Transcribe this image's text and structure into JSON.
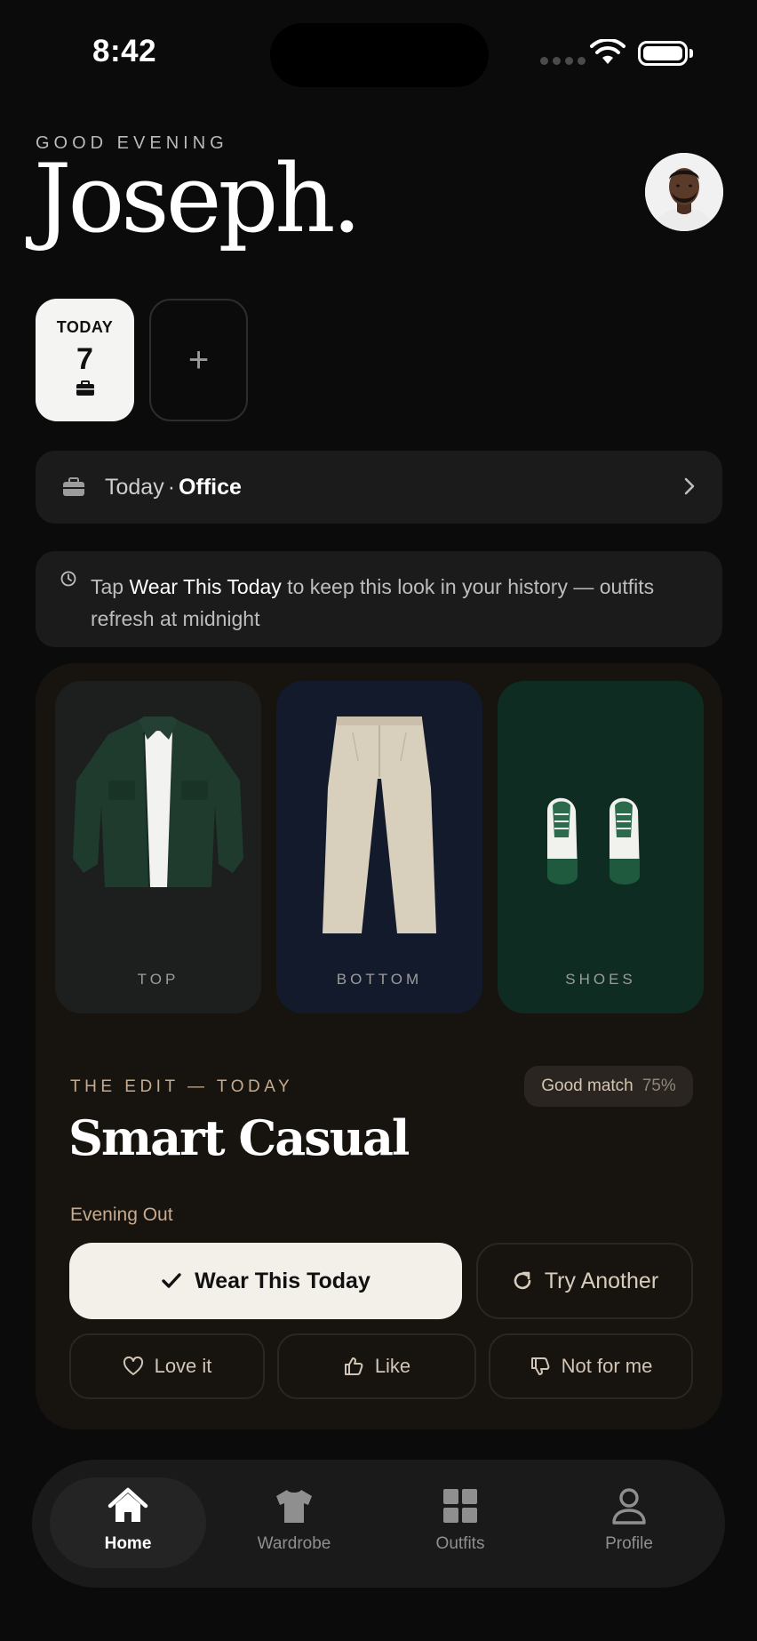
{
  "status_bar": {
    "time": "8:42"
  },
  "header": {
    "greeting": "GOOD EVENING",
    "name": "Joseph."
  },
  "date_chips": {
    "today_label": "TODAY",
    "today_number": "7",
    "add_label": "+"
  },
  "occasion": {
    "day": "Today",
    "separator": "·",
    "event": "Office"
  },
  "info_banner": {
    "prefix": "Tap ",
    "highlight": "Wear This Today",
    "suffix": " to keep this look in your history — outfits refresh at midnight"
  },
  "outfit": {
    "pieces": [
      {
        "label": "TOP"
      },
      {
        "label": "BOTTOM"
      },
      {
        "label": "SHOES"
      }
    ],
    "eyebrow": "THE EDIT — TODAY",
    "match_label": "Good match",
    "match_percent": "75%",
    "title": "Smart Casual",
    "occasion": "Evening Out",
    "wear_button": "Wear This Today",
    "try_button": "Try Another",
    "reactions": {
      "love": "Love it",
      "like": "Like",
      "dislike": "Not for me"
    }
  },
  "nav": {
    "items": [
      {
        "label": "Home",
        "icon": "home-icon",
        "active": true
      },
      {
        "label": "Wardrobe",
        "icon": "shirt-icon",
        "active": false
      },
      {
        "label": "Outfits",
        "icon": "grid-icon",
        "active": false
      },
      {
        "label": "Profile",
        "icon": "person-icon",
        "active": false
      }
    ]
  },
  "colors": {
    "background": "#0b0b0b",
    "accent_tan": "#c7ab8e",
    "card": "#17140f",
    "shoes_tile": "#0f2c22",
    "bottom_tile": "#121a2c"
  }
}
